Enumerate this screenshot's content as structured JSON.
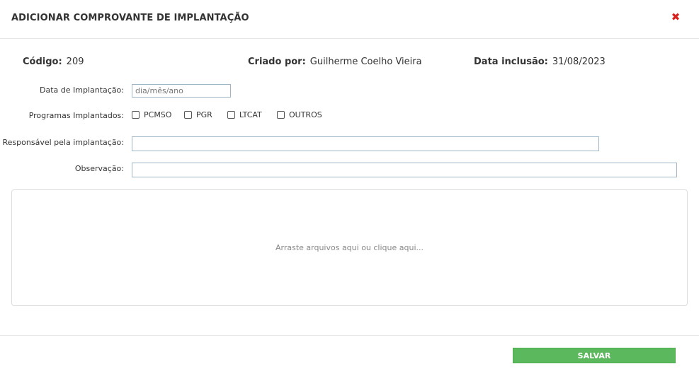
{
  "modal": {
    "title": "ADICIONAR COMPROVANTE DE IMPLANTAÇÃO",
    "close_icon": "close-icon"
  },
  "info": {
    "codigo_label": "Código:",
    "codigo_value": "209",
    "criado_label": "Criado por:",
    "criado_value": "Guilherme Coelho Vieira",
    "data_label": "Data inclusão:",
    "data_value": "31/08/2023"
  },
  "form": {
    "data_implantacao_label": "Data de Implantação:",
    "data_implantacao_placeholder": "dia/mês/ano",
    "programas_label": "Programas Implantados:",
    "programas": [
      "PCMSO",
      "PGR",
      "LTCAT",
      "OUTROS"
    ],
    "responsavel_label": "Responsável pela implantação:",
    "observacao_label": "Observação:"
  },
  "dropzone": {
    "text": "Arraste arquivos aqui ou clique aqui..."
  },
  "footer": {
    "save_label": "SALVAR"
  },
  "colors": {
    "save": "#5cb85c",
    "close": "#d9211d",
    "input_border": "#9fb6c6"
  }
}
